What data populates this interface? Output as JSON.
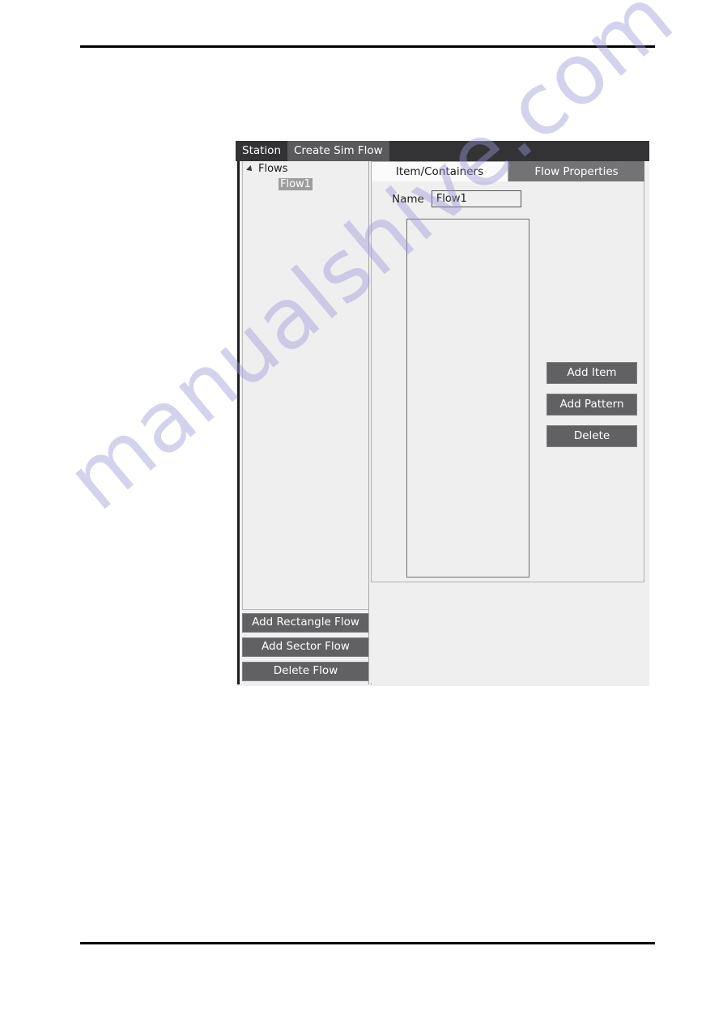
{
  "page": {
    "rule_color": "#000000"
  },
  "watermark": {
    "text": "manualshive.com",
    "color": "#9a97d8"
  },
  "window": {
    "title_bar": {
      "items": [
        {
          "label": "Station",
          "active": false
        },
        {
          "label": "Create Sim Flow",
          "active": true
        }
      ],
      "background_color": "#333336",
      "active_item_color": "#5a5a5c"
    },
    "left_panel": {
      "tree": {
        "root": {
          "label": "Flows",
          "expander_icon": "triangle-expanded-icon"
        },
        "children": [
          {
            "label": "Flow1",
            "selected": true
          }
        ],
        "selection_color": "#9d9d9d"
      },
      "buttons": [
        {
          "label": "Add Rectangle Flow",
          "name": "add-rectangle-flow-button"
        },
        {
          "label": "Add Sector Flow",
          "name": "add-sector-flow-button"
        },
        {
          "label": "Delete Flow",
          "name": "delete-flow-button"
        }
      ]
    },
    "right_panel": {
      "tabs": [
        {
          "label": "Item/Containers",
          "active": true
        },
        {
          "label": "Flow Properties",
          "active": false
        }
      ],
      "name_field": {
        "label": "Name",
        "value": "Flow1",
        "placeholder": ""
      },
      "item_list": {
        "items": []
      },
      "buttons": [
        {
          "label": "Add Item",
          "name": "add-item-button"
        },
        {
          "label": "Add Pattern",
          "name": "add-pattern-button"
        },
        {
          "label": "Delete",
          "name": "delete-button"
        }
      ]
    },
    "button_color": "#616163",
    "panel_background": "#efefef"
  }
}
